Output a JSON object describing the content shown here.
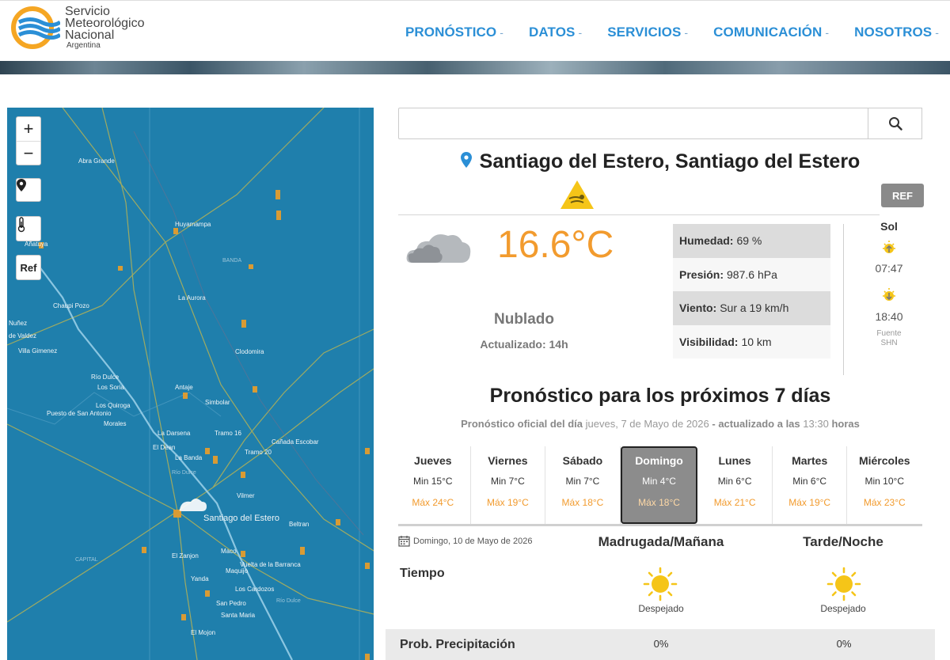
{
  "header": {
    "logo_lines": [
      "Servicio",
      "Meteorológico",
      "Nacional"
    ],
    "logo_country": "Argentina",
    "nav": [
      {
        "label": "PRONÓSTICO"
      },
      {
        "label": "DATOS"
      },
      {
        "label": "SERVICIOS"
      },
      {
        "label": "COMUNICACIÓN"
      },
      {
        "label": "NOSOTROS"
      }
    ],
    "caret": "-"
  },
  "map": {
    "zoom_in": "+",
    "zoom_out": "−",
    "ref_button": "Ref",
    "labels": [
      {
        "t": "Abra Grande"
      },
      {
        "t": "Huyamampa"
      },
      {
        "t": "BANDA"
      },
      {
        "t": "Añatuya"
      },
      {
        "t": "La Aurora"
      },
      {
        "t": "Chaupi Pozo"
      },
      {
        "t": "Nuñez"
      },
      {
        "t": "de Valdez"
      },
      {
        "t": "Villa Gimenez"
      },
      {
        "t": "Clodomira"
      },
      {
        "t": "Río Dulce"
      },
      {
        "t": "Los Soria"
      },
      {
        "t": "Antaje"
      },
      {
        "t": "Los Quiroga"
      },
      {
        "t": "Puesto de San Antonio"
      },
      {
        "t": "Simbolar"
      },
      {
        "t": "Morales"
      },
      {
        "t": "La Darsena"
      },
      {
        "t": "Tramo 16"
      },
      {
        "t": "Cañada Escobar"
      },
      {
        "t": "El Dean"
      },
      {
        "t": "Tramo 20"
      },
      {
        "t": "La Banda"
      },
      {
        "t": "Río Dulce"
      },
      {
        "t": "Vilmer"
      },
      {
        "t": "Santiago del Estero"
      },
      {
        "t": "Beltran"
      },
      {
        "t": "CAPITAL"
      },
      {
        "t": "El Zanjon"
      },
      {
        "t": "Maco"
      },
      {
        "t": "Vuelta de la Barranca"
      },
      {
        "t": "Maquijo"
      },
      {
        "t": "Yanda"
      },
      {
        "t": "Los Cardozos"
      },
      {
        "t": "San Pedro"
      },
      {
        "t": "Santa Maria"
      },
      {
        "t": "El Mojon"
      },
      {
        "t": "Río Dulce"
      }
    ]
  },
  "search": {
    "placeholder": ""
  },
  "location": {
    "title": "Santiago del Estero, Santiago del Estero",
    "ref_button": "REF"
  },
  "current": {
    "temperature": "16.6°C",
    "condition": "Nublado",
    "updated": "Actualizado: 14h",
    "stats": [
      {
        "label": "Humedad:",
        "value": "69 %"
      },
      {
        "label": "Presión:",
        "value": "987.6 hPa"
      },
      {
        "label": "Viento:",
        "value": "Sur a 19 km/h"
      },
      {
        "label": "Visibilidad:",
        "value": "10 km"
      }
    ],
    "sun": {
      "title": "Sol",
      "sunrise": "07:47",
      "sunset": "18:40",
      "source_1": "Fuente",
      "source_2": "SHN"
    }
  },
  "forecast": {
    "title": "Pronóstico para los próximos 7 días",
    "sub_a": "Pronóstico oficial del día",
    "sub_date": "jueves, 7 de Mayo de 2026",
    "sub_b": "- actualizado a las",
    "sub_time": "13:30",
    "sub_c": "horas",
    "days": [
      {
        "name": "Jueves",
        "min": "Min 15°C",
        "max": "Máx 24°C"
      },
      {
        "name": "Viernes",
        "min": "Min 7°C",
        "max": "Máx 19°C"
      },
      {
        "name": "Sábado",
        "min": "Min 7°C",
        "max": "Máx 18°C"
      },
      {
        "name": "Domingo",
        "min": "Min 4°C",
        "max": "Máx 18°C"
      },
      {
        "name": "Lunes",
        "min": "Min 6°C",
        "max": "Máx 21°C"
      },
      {
        "name": "Martes",
        "min": "Min 6°C",
        "max": "Máx 19°C"
      },
      {
        "name": "Miércoles",
        "min": "Min 10°C",
        "max": "Máx 23°C"
      }
    ],
    "selected_day_index": 3
  },
  "detail": {
    "date": "Domingo, 10 de Mayo de 2026",
    "col_morning": "Madrugada/Mañana",
    "col_evening": "Tarde/Noche",
    "row_weather": "Tiempo",
    "weather_morning": "Despejado",
    "weather_evening": "Despejado",
    "row_precip": "Prob. Precipitación",
    "precip_morning": "0%",
    "precip_evening": "0%"
  },
  "colors": {
    "nav": "#2b8fd6",
    "temperature": "#f29b2e",
    "map_water": "#1f7fac",
    "selected_day_bg": "#8c8c8c",
    "warning_yellow": "#f5c518"
  }
}
